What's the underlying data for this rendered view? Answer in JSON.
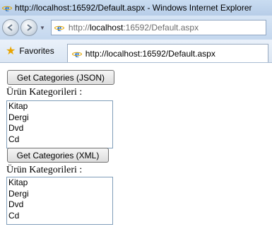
{
  "window": {
    "title": "http://localhost:16592/Default.aspx - Windows Internet Explorer"
  },
  "navigation": {
    "address_prefix": "http://",
    "address_host": "localhost",
    "address_rest": ":16592/Default.aspx"
  },
  "favorites_bar": {
    "favorites_label": "Favorites",
    "tab_title": "http://localhost:16592/Default.aspx"
  },
  "page": {
    "json_section": {
      "button_label": "Get Categories (JSON)",
      "label": "Ürün Kategorileri :",
      "items": [
        "Kitap",
        "Dergi",
        "Dvd",
        "Cd"
      ]
    },
    "xml_section": {
      "button_label": "Get Categories (XML)",
      "label": "Ürün Kategorileri :",
      "items": [
        "Kitap",
        "Dergi",
        "Dvd",
        "Cd"
      ]
    }
  },
  "colors": {
    "ie_blue": "#1e6fd0",
    "star": "#e8a400",
    "chrome": "#c4d7ee"
  },
  "icons": [
    "ie-logo-icon",
    "back-arrow-icon",
    "forward-arrow-icon",
    "favorites-star-icon"
  ]
}
